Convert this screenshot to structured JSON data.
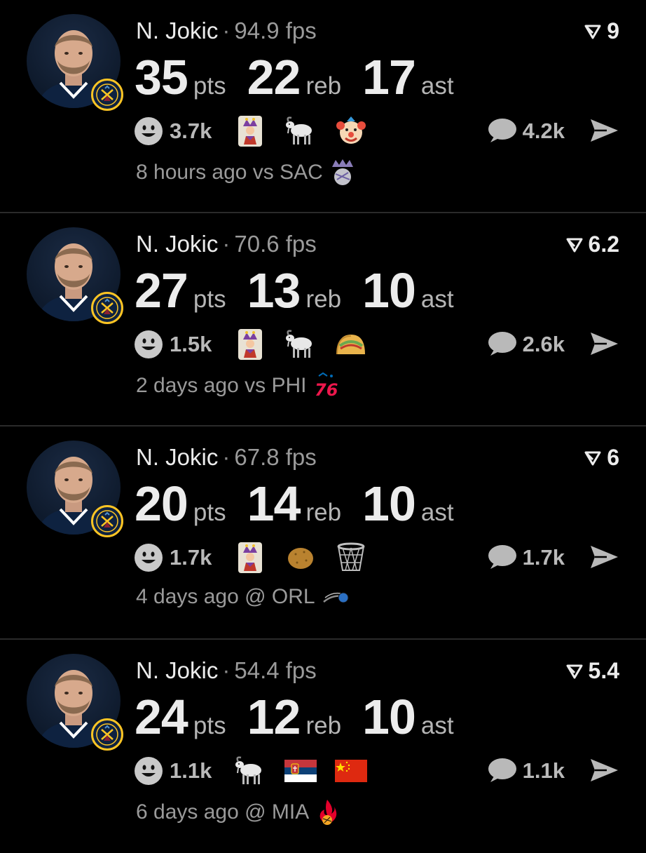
{
  "posts": [
    {
      "player": "N. Jokic",
      "separator": "·",
      "fps": "94.9 fps",
      "score": "9",
      "stats": [
        {
          "value": "35",
          "unit": "pts"
        },
        {
          "value": "22",
          "unit": "reb"
        },
        {
          "value": "17",
          "unit": "ast"
        }
      ],
      "reaction_count": "3.7k",
      "emojis": [
        "joker-card-icon",
        "goat-icon",
        "clown-face-icon"
      ],
      "comment_count": "4.2k",
      "game": "8 hours ago vs SAC",
      "opponent_logo": "kings-logo-icon"
    },
    {
      "player": "N. Jokic",
      "separator": "·",
      "fps": "70.6 fps",
      "score": "6.2",
      "stats": [
        {
          "value": "27",
          "unit": "pts"
        },
        {
          "value": "13",
          "unit": "reb"
        },
        {
          "value": "10",
          "unit": "ast"
        }
      ],
      "reaction_count": "1.5k",
      "emojis": [
        "joker-card-icon",
        "goat-icon",
        "taco-icon"
      ],
      "comment_count": "2.6k",
      "game": "2 days ago vs PHI",
      "opponent_logo": "76ers-logo-icon"
    },
    {
      "player": "N. Jokic",
      "separator": "·",
      "fps": "67.8 fps",
      "score": "6",
      "stats": [
        {
          "value": "20",
          "unit": "pts"
        },
        {
          "value": "14",
          "unit": "reb"
        },
        {
          "value": "10",
          "unit": "ast"
        }
      ],
      "reaction_count": "1.7k",
      "emojis": [
        "joker-card-icon",
        "potato-icon",
        "basketball-net-icon"
      ],
      "comment_count": "1.7k",
      "game": "4 days ago @ ORL",
      "opponent_logo": "magic-logo-icon"
    },
    {
      "player": "N. Jokic",
      "separator": "·",
      "fps": "54.4 fps",
      "score": "5.4",
      "stats": [
        {
          "value": "24",
          "unit": "pts"
        },
        {
          "value": "12",
          "unit": "reb"
        },
        {
          "value": "10",
          "unit": "ast"
        }
      ],
      "reaction_count": "1.1k",
      "emojis": [
        "goat-icon",
        "serbia-flag-icon",
        "china-flag-icon"
      ],
      "comment_count": "1.1k",
      "game": "6 days ago @ MIA",
      "opponent_logo": "heat-logo-icon"
    }
  ],
  "colors": {
    "background": "#000000",
    "divider": "#2a2a2a",
    "nuggets_navy": "#0e2240",
    "nuggets_gold": "#fec524"
  }
}
